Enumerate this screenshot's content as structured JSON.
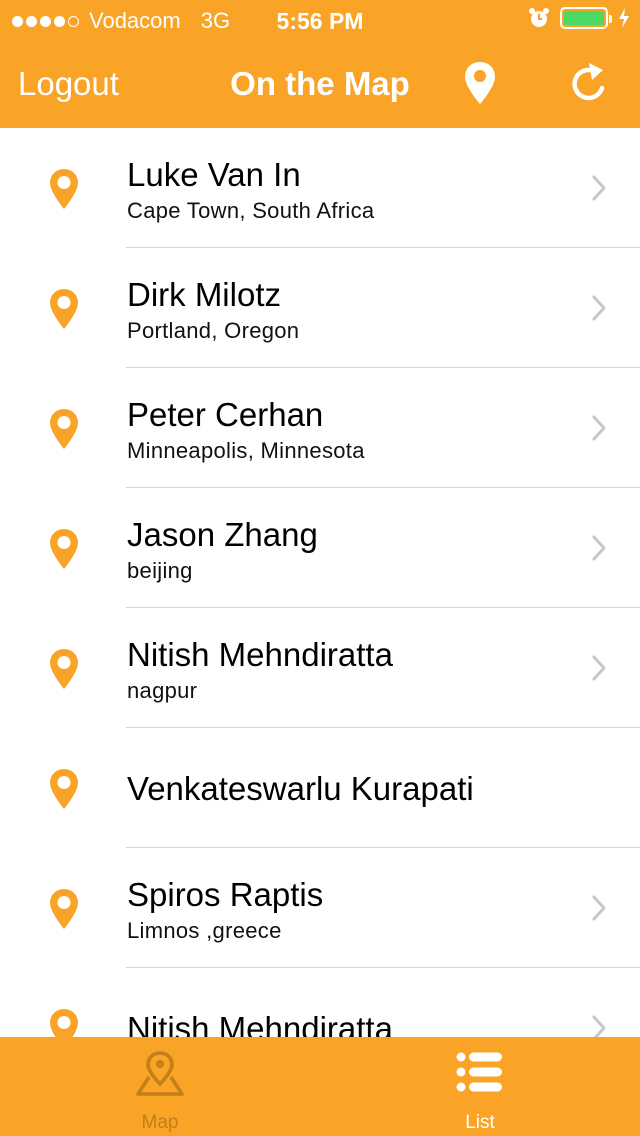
{
  "status_bar": {
    "carrier": "Vodacom",
    "network": "3G",
    "time": "5:56 PM",
    "signal_bars_filled": 4,
    "signal_bars_total": 5,
    "battery_level": 1.0,
    "icons": [
      "alarm-icon",
      "battery-icon",
      "charging-icon"
    ]
  },
  "navbar": {
    "left_button": "Logout",
    "title": "On the Map",
    "right_icons": [
      "pin-icon",
      "refresh-icon"
    ]
  },
  "students": [
    {
      "name": "Luke Van In",
      "location": "Cape Town, South Africa",
      "has_link": true
    },
    {
      "name": "Dirk Milotz",
      "location": "Portland, Oregon",
      "has_link": true
    },
    {
      "name": "Peter Cerhan",
      "location": "Minneapolis, Minnesota",
      "has_link": true
    },
    {
      "name": "Jason Zhang",
      "location": "beijing",
      "has_link": true
    },
    {
      "name": "Nitish Mehndiratta",
      "location": "nagpur",
      "has_link": true
    },
    {
      "name": "Venkateswarlu Kurapati",
      "location": "",
      "has_link": false
    },
    {
      "name": "Spiros Raptis",
      "location": "Limnos ,greece",
      "has_link": true
    },
    {
      "name": "Nitish Mehndiratta",
      "location": "",
      "has_link": true
    }
  ],
  "tabbar": {
    "tabs": [
      {
        "label": "Map",
        "icon": "map-icon",
        "selected": false
      },
      {
        "label": "List",
        "icon": "list-icon",
        "selected": true
      }
    ]
  },
  "colors": {
    "accent": "#F9A327",
    "pin": "#F9A327",
    "chevron": "#C7C7CC",
    "divider": "#D6D6D9",
    "tab_inactive": "#C47E1A"
  }
}
